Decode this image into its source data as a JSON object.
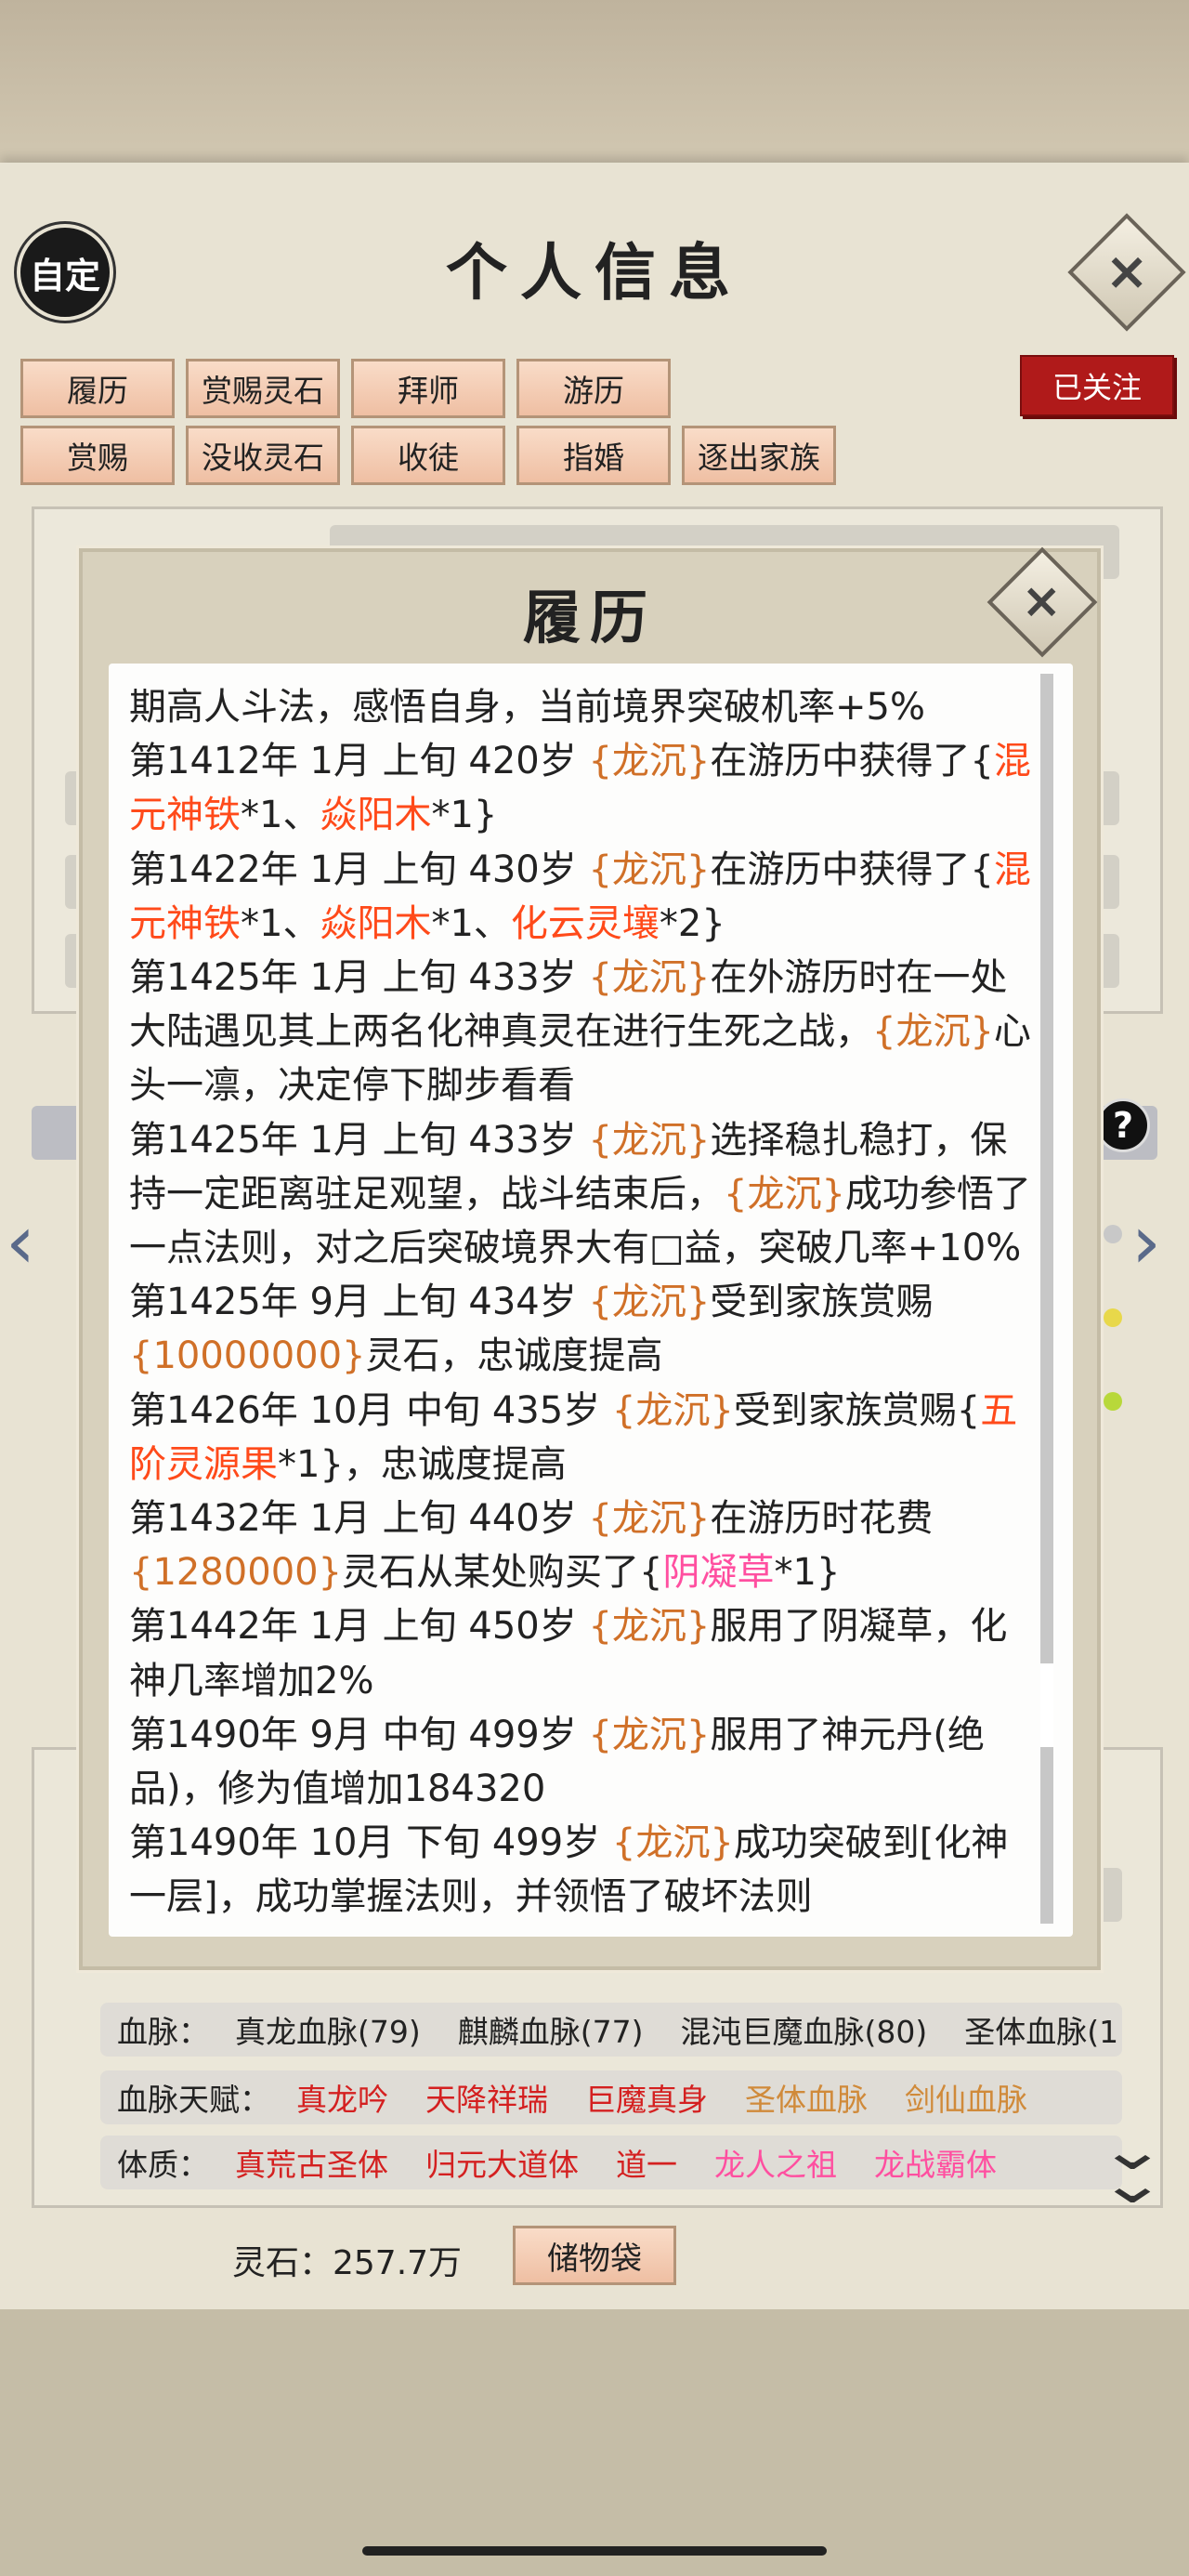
{
  "header": {
    "badge": "自定",
    "title": "个人信息"
  },
  "tabs_row1": [
    "履历",
    "赏赐灵石",
    "拜师",
    "游历"
  ],
  "tabs_row2": [
    "赏赐",
    "没收灵石",
    "收徒",
    "指婚",
    "逐出家族"
  ],
  "follow_label": "已关注",
  "modal": {
    "title": "履历",
    "entries": [
      [
        {
          "t": "期高人斗法，感悟自身，当前境界突破机率+5%"
        }
      ],
      [
        {
          "t": "第1412年 1月 上旬 420岁 "
        },
        {
          "t": "{龙沉}",
          "c": "or"
        },
        {
          "t": "在游历中获得了{"
        },
        {
          "t": "混元神铁",
          "c": "red"
        },
        {
          "t": "*1、"
        },
        {
          "t": "焱阳木",
          "c": "red"
        },
        {
          "t": "*1}"
        }
      ],
      [
        {
          "t": "第1422年 1月 上旬 430岁 "
        },
        {
          "t": "{龙沉}",
          "c": "or"
        },
        {
          "t": "在游历中获得了{"
        },
        {
          "t": "混元神铁",
          "c": "red"
        },
        {
          "t": "*1、"
        },
        {
          "t": "焱阳木",
          "c": "red"
        },
        {
          "t": "*1、"
        },
        {
          "t": "化云灵壤",
          "c": "red"
        },
        {
          "t": "*2}"
        }
      ],
      [
        {
          "t": "第1425年 1月 上旬 433岁 "
        },
        {
          "t": "{龙沉}",
          "c": "or"
        },
        {
          "t": "在外游历时在一处大陆遇见其上两名化神真灵在进行生死之战，"
        },
        {
          "t": "{龙沉}",
          "c": "or"
        },
        {
          "t": "心头一凛，决定停下脚步看看"
        }
      ],
      [
        {
          "t": "第1425年 1月 上旬 433岁 "
        },
        {
          "t": "{龙沉}",
          "c": "or"
        },
        {
          "t": "选择稳扎稳打，保持一定距离驻足观望，战斗结束后，"
        },
        {
          "t": "{龙沉}",
          "c": "or"
        },
        {
          "t": "成功参悟了一点法则，对之后突破境界大有□益，突破几率+10%"
        }
      ],
      [
        {
          "t": "第1425年  9月  上旬    434岁    "
        },
        {
          "t": "{龙沉}",
          "c": "or"
        },
        {
          "t": "受到家族赏赐"
        },
        {
          "t": "{10000000}",
          "c": "or"
        },
        {
          "t": "灵石，忠诚度提高"
        }
      ],
      [
        {
          "t": "第1426年 10月 中旬 435岁 "
        },
        {
          "t": "{龙沉}",
          "c": "or"
        },
        {
          "t": "受到家族赏赐{"
        },
        {
          "t": "五阶灵源果",
          "c": "red"
        },
        {
          "t": "*1}，忠诚度提高"
        }
      ],
      [
        {
          "t": "第1432年  1月  上旬    440岁    "
        },
        {
          "t": "{龙沉}",
          "c": "or"
        },
        {
          "t": "在游历时花费"
        },
        {
          "t": "{1280000}",
          "c": "or"
        },
        {
          "t": "灵石从某处购买了{"
        },
        {
          "t": "阴凝草",
          "c": "pink"
        },
        {
          "t": "*1}"
        }
      ],
      [
        {
          "t": "第1442年 1月 上旬 450岁 "
        },
        {
          "t": "{龙沉}",
          "c": "or"
        },
        {
          "t": "服用了阴凝草，化神几率增加2%"
        }
      ],
      [
        {
          "t": "第1490年  9月  中旬    499岁    "
        },
        {
          "t": "{龙沉}",
          "c": "or"
        },
        {
          "t": "服用了神元丹(绝品)，修为值增加184320"
        }
      ],
      [
        {
          "t": "第1490年 10月 下旬  499岁  "
        },
        {
          "t": "{龙沉}",
          "c": "or"
        },
        {
          "t": "成功突破到[化神一层]，成功掌握法则，并领悟了破坏法则"
        }
      ]
    ]
  },
  "rows": {
    "bloodline": {
      "label": "血脉：",
      "items": [
        "真龙血脉(79)",
        "麒麟血脉(77)",
        "混沌巨魔血脉(80)",
        "圣体血脉(1"
      ]
    },
    "talent": {
      "label": "血脉天赋：",
      "items": [
        {
          "t": "真龙吟",
          "c": "#d42020"
        },
        {
          "t": "天降祥瑞",
          "c": "#d42020"
        },
        {
          "t": "巨魔真身",
          "c": "#d42020"
        },
        {
          "t": "圣体血脉",
          "c": "#d08a3a"
        },
        {
          "t": "剑仙血脉",
          "c": "#d08a3a"
        }
      ]
    },
    "physique": {
      "label": "体质：",
      "items": [
        {
          "t": "真荒古圣体",
          "c": "#d42020"
        },
        {
          "t": "归元大道体",
          "c": "#d42020"
        },
        {
          "t": "道一",
          "c": "#d42020"
        },
        {
          "t": "龙人之祖",
          "c": "#ff4fa0"
        },
        {
          "t": "龙战霸体",
          "c": "#ff4fa0"
        }
      ]
    }
  },
  "footer": {
    "stones": "灵石：257.7万",
    "storage": "储物袋"
  },
  "icons": [
    "close-icon",
    "help-icon",
    "left-arrow-icon",
    "right-arrow-icon",
    "double-chevron-down-icon"
  ]
}
